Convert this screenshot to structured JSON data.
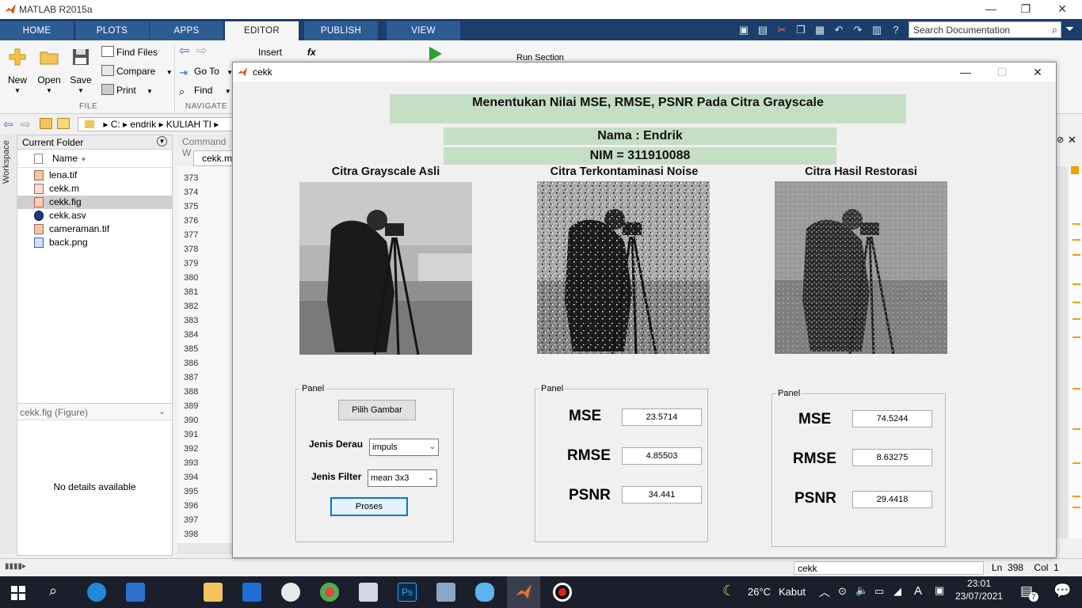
{
  "app": {
    "title": "MATLAB R2015a",
    "window_controls": {
      "minimize": "—",
      "restore": "❐",
      "close": "✕"
    }
  },
  "ribbon": {
    "tabs": [
      {
        "label": "HOME"
      },
      {
        "label": "PLOTS"
      },
      {
        "label": "APPS"
      },
      {
        "label": "EDITOR"
      },
      {
        "label": "PUBLISH"
      },
      {
        "label": "VIEW"
      }
    ],
    "active_tab": "EDITOR",
    "search_placeholder": "Search Documentation",
    "file_group": {
      "label": "FILE",
      "new": "New",
      "open": "Open",
      "save": "Save",
      "find_files": "Find Files",
      "compare": "Compare",
      "print": "Print"
    },
    "navigate_group": {
      "label": "NAVIGATE",
      "go_to": "Go To",
      "find": "Find"
    },
    "edit_group": {
      "insert": "Insert",
      "fx": "fx"
    },
    "run_group": {
      "run_section": "Run Section"
    }
  },
  "address": {
    "segments": [
      "C:",
      "endrik",
      "KULIAH TI"
    ]
  },
  "workspace_label": "Workspace",
  "current_folder": {
    "title": "Current Folder",
    "column": "Name",
    "files": [
      {
        "name": "lena.tif",
        "icon": "image-file-icon"
      },
      {
        "name": "cekk.m",
        "icon": "m-file-icon"
      },
      {
        "name": "cekk.fig",
        "icon": "fig-file-icon"
      },
      {
        "name": "cekk.asv",
        "icon": "asv-file-icon"
      },
      {
        "name": "cameraman.tif",
        "icon": "image-file-icon"
      },
      {
        "name": "back.png",
        "icon": "png-file-icon"
      }
    ],
    "selected": "cekk.fig",
    "details_title": "cekk.fig (Figure)",
    "details_empty": "No details available"
  },
  "editor": {
    "command_window_label": "Command W",
    "tab_label": "cekk.m",
    "line_numbers": [
      "373",
      "374",
      "375",
      "376",
      "377",
      "378",
      "379",
      "380",
      "381",
      "382",
      "383",
      "384",
      "385",
      "386",
      "387",
      "388",
      "389",
      "390",
      "391",
      "392",
      "393",
      "394",
      "395",
      "396",
      "397",
      "398"
    ]
  },
  "status_bar": {
    "script_name": "cekk",
    "ln_label": "Ln",
    "ln_value": "398",
    "col_label": "Col",
    "col_value": "1"
  },
  "figure": {
    "title": "cekk",
    "header": "Menentukan Nilai MSE, RMSE, PSNR Pada Citra Grayscale",
    "name": "Nama : Endrik",
    "nim": "NIM = 311910088",
    "images": [
      {
        "title": "Citra Grayscale Asli"
      },
      {
        "title": "Citra Terkontaminasi Noise"
      },
      {
        "title": "Citra Hasil Restorasi"
      }
    ],
    "control_panel": {
      "title": "Panel",
      "pick_button": "Pilih Gambar",
      "noise_label": "Jenis Derau",
      "noise_value": "impuls",
      "filter_label": "Jenis Filter",
      "filter_value": "mean 3x3",
      "process_button": "Proses"
    },
    "noise_panel": {
      "title": "Panel",
      "mse_label": "MSE",
      "mse_value": "23.5714",
      "rmse_label": "RMSE",
      "rmse_value": "4.85503",
      "psnr_label": "PSNR",
      "psnr_value": "34.441"
    },
    "restore_panel": {
      "title": "Panel",
      "mse_label": "MSE",
      "mse_value": "74.5244",
      "rmse_label": "RMSE",
      "rmse_value": "8.63275",
      "psnr_label": "PSNR",
      "psnr_value": "29.4418"
    }
  },
  "taskbar": {
    "weather_temp": "26°C",
    "weather_text": "Kabut",
    "time": "23:01",
    "date": "23/07/2021",
    "notification_count": "7",
    "ime": "A"
  },
  "colors": {
    "ribbon_tab_bar": "#1c3e6b",
    "ribbon_tab": "#2d5b94",
    "green_label_bg": "#c5dfc5",
    "taskbar": "#1b1f2b"
  }
}
